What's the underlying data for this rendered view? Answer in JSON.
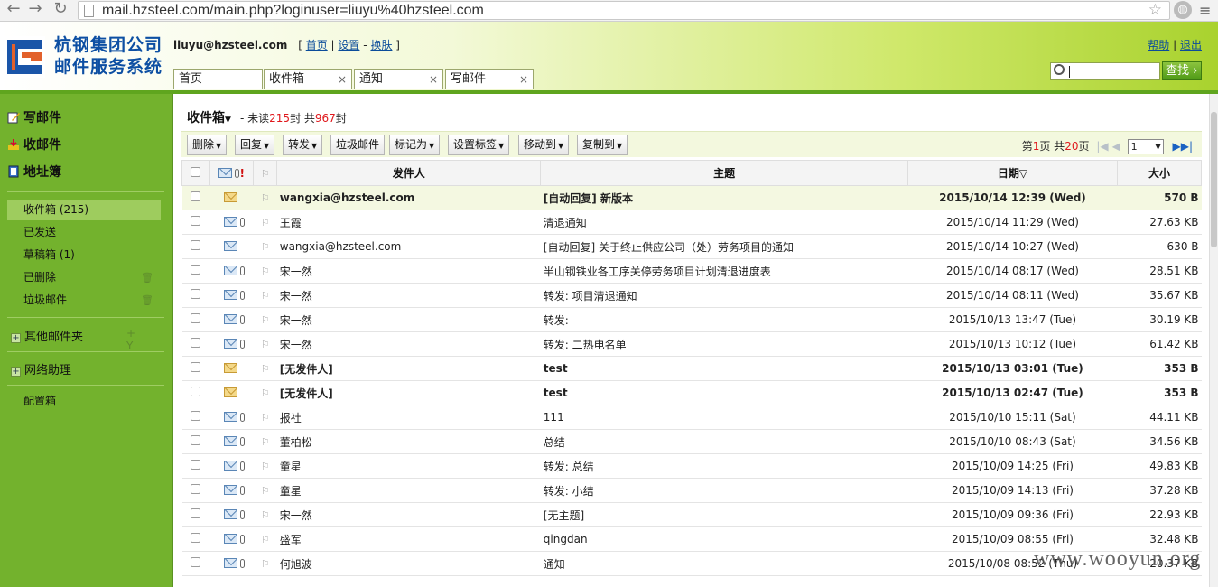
{
  "browser": {
    "url": "mail.hzsteel.com/main.php?loginuser=liuyu%40hzsteel.com"
  },
  "header": {
    "logo_line1": "杭钢集团公司",
    "logo_line2": "邮件服务系统",
    "user_email": "liuyu@hzsteel.com",
    "bracket_open": "[",
    "bracket_close": "]",
    "link_home": "首页",
    "link_settings": "设置",
    "link_skin": "换肤",
    "sep": "-",
    "link_help": "帮助",
    "link_logout": "退出",
    "link_sep": "|",
    "search_button": "查找",
    "tabs": [
      {
        "label": "首页"
      },
      {
        "label": "收件箱",
        "close": "×"
      },
      {
        "label": "通知",
        "close": "×"
      },
      {
        "label": "写邮件",
        "close": "×"
      }
    ]
  },
  "sidebar": {
    "compose": "写邮件",
    "receive": "收邮件",
    "addressbook": "地址簿",
    "folders": [
      {
        "label": "收件箱 (215)"
      },
      {
        "label": "已发送"
      },
      {
        "label": "草稿箱 (1)"
      },
      {
        "label": "已删除"
      },
      {
        "label": "垃圾邮件"
      }
    ],
    "other_folders": "其他邮件夹",
    "other_actions": "+ Y",
    "network_assist": "网络助理",
    "config_box": "配置箱"
  },
  "main": {
    "folder_title": "收件箱",
    "unread_prefix": "- 未读",
    "unread_count": "215",
    "unread_mid": "封 共",
    "total_count": "967",
    "unread_suffix": "封",
    "toolbar": {
      "delete": "删除",
      "reply": "回复",
      "forward": "转发",
      "junk": "垃圾邮件",
      "mark_as": "标记为",
      "set_tag": "设置标签",
      "move_to": "移动到",
      "copy_to": "复制到"
    },
    "pager": {
      "pre": "第",
      "current": "1",
      "mid": "页 共",
      "total": "20",
      "post": "页",
      "select_value": "1"
    },
    "columns": {
      "sender": "发件人",
      "subject": "主题",
      "date": "日期▽",
      "size": "大小"
    },
    "rows": [
      {
        "sender": "wangxia@hzsteel.com",
        "subject": "[自动回复] 新版本",
        "date": "2015/10/14 12:39 (Wed)",
        "size": "570 B",
        "unread": true,
        "clip": false
      },
      {
        "sender": "王霞",
        "subject": "清退通知",
        "date": "2015/10/14 11:29 (Wed)",
        "size": "27.63 KB",
        "unread": false,
        "clip": true
      },
      {
        "sender": "wangxia@hzsteel.com",
        "subject": "[自动回复] 关于终止供应公司（处）劳务项目的通知",
        "date": "2015/10/14 10:27 (Wed)",
        "size": "630 B",
        "unread": false,
        "clip": false
      },
      {
        "sender": "宋一然",
        "subject": "半山钢铁业各工序关停劳务项目计划清退进度表",
        "date": "2015/10/14 08:17 (Wed)",
        "size": "28.51 KB",
        "unread": false,
        "clip": true
      },
      {
        "sender": "宋一然",
        "subject": "转发: 项目清退通知",
        "date": "2015/10/14 08:11 (Wed)",
        "size": "35.67 KB",
        "unread": false,
        "clip": true
      },
      {
        "sender": "宋一然",
        "subject": "转发:",
        "date": "2015/10/13 13:47 (Tue)",
        "size": "30.19 KB",
        "unread": false,
        "clip": true
      },
      {
        "sender": "宋一然",
        "subject": "转发: 二热电名单",
        "date": "2015/10/13 10:12 (Tue)",
        "size": "61.42 KB",
        "unread": false,
        "clip": true
      },
      {
        "sender": "[无发件人]",
        "subject": "test",
        "date": "2015/10/13 03:01 (Tue)",
        "size": "353 B",
        "unread": true,
        "clip": false
      },
      {
        "sender": "[无发件人]",
        "subject": "test",
        "date": "2015/10/13 02:47 (Tue)",
        "size": "353 B",
        "unread": true,
        "clip": false
      },
      {
        "sender": "报社",
        "subject": "111",
        "date": "2015/10/10 15:11 (Sat)",
        "size": "44.11 KB",
        "unread": false,
        "clip": true
      },
      {
        "sender": "董柏松",
        "subject": "总结",
        "date": "2015/10/10 08:43 (Sat)",
        "size": "34.56 KB",
        "unread": false,
        "clip": true
      },
      {
        "sender": "童星",
        "subject": "转发: 总结",
        "date": "2015/10/09 14:25 (Fri)",
        "size": "49.83 KB",
        "unread": false,
        "clip": true
      },
      {
        "sender": "童星",
        "subject": "转发: 小结",
        "date": "2015/10/09 14:13 (Fri)",
        "size": "37.28 KB",
        "unread": false,
        "clip": true
      },
      {
        "sender": "宋一然",
        "subject": "[无主题]",
        "date": "2015/10/09 09:36 (Fri)",
        "size": "22.93 KB",
        "unread": false,
        "clip": true
      },
      {
        "sender": "盛军",
        "subject": "qingdan",
        "date": "2015/10/09 08:55 (Fri)",
        "size": "32.48 KB",
        "unread": false,
        "clip": true
      },
      {
        "sender": "何旭波",
        "subject": "通知",
        "date": "2015/10/08 08:52 (Thu)",
        "size": "20.37 KB",
        "unread": false,
        "clip": true
      }
    ]
  },
  "watermark": "www.wooyun.org"
}
